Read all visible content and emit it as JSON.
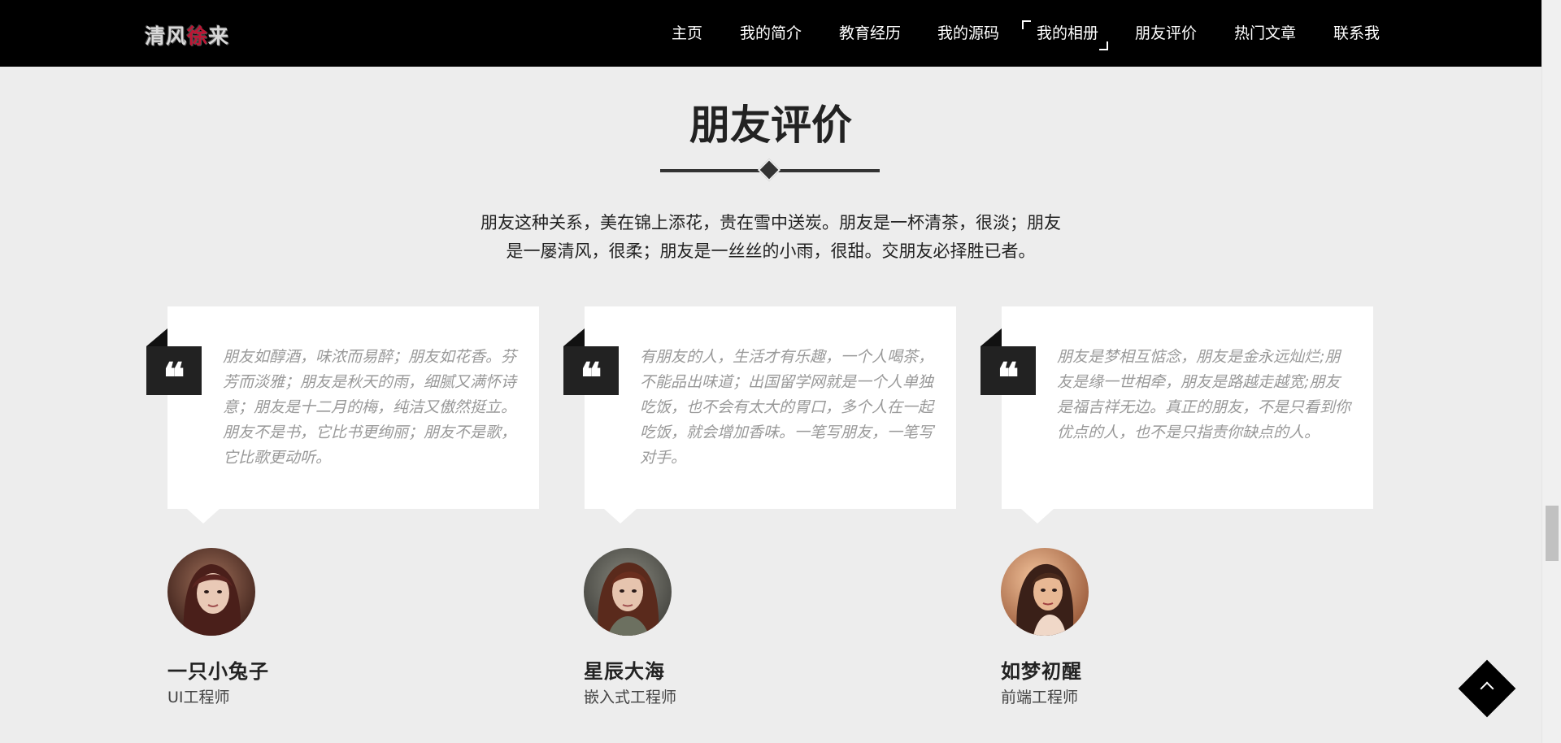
{
  "header": {
    "logo": {
      "part1": "清风",
      "part2": "徐",
      "part3": "来"
    },
    "nav": [
      {
        "label": "主页"
      },
      {
        "label": "我的简介"
      },
      {
        "label": "教育经历"
      },
      {
        "label": "我的源码"
      },
      {
        "label": "我的相册"
      },
      {
        "label": "朋友评价"
      },
      {
        "label": "热门文章"
      },
      {
        "label": "联系我"
      }
    ]
  },
  "section": {
    "title": "朋友评价",
    "intro_line1": "朋友这种关系，美在锦上添花，贵在雪中送炭。朋友是一杯清茶，很淡；朋友",
    "intro_line2": "是一屡清风，很柔；朋友是一丝丝的小雨，很甜。交朋友必择胜已者。"
  },
  "testimonials": [
    {
      "quote_icon": "❝",
      "text": "朋友如醇酒，味浓而易醉；朋友如花香。芬芳而淡雅；朋友是秋天的雨，细腻又满怀诗意；朋友是十二月的梅，纯洁又傲然挺立。朋友不是书，它比书更绚丽；朋友不是歌，它比歌更动听。",
      "name": "一只小兔子",
      "role": "UI工程师"
    },
    {
      "quote_icon": "❝",
      "text": "有朋友的人，生活才有乐趣，一个人喝茶，不能品出味道；出国留学网就是一个人单独吃饭，也不会有太大的胃口，多个人在一起吃饭，就会增加香味。一笔写朋友，一笔写对手。",
      "name": "星辰大海",
      "role": "嵌入式工程师"
    },
    {
      "quote_icon": "❝",
      "text": "朋友是梦相互惦念，朋友是金永远灿烂;朋友是缘一世相牵，朋友是路越走越宽;朋友是福吉祥无边。真正的朋友，不是只看到你优点的人，也不是只指责你缺点的人。",
      "name": "如梦初醒",
      "role": "前端工程师"
    }
  ],
  "colors": {
    "header_bg": "#000000",
    "page_bg": "#ededed",
    "logo_accent": "#c01434",
    "quote_text": "#999999"
  }
}
